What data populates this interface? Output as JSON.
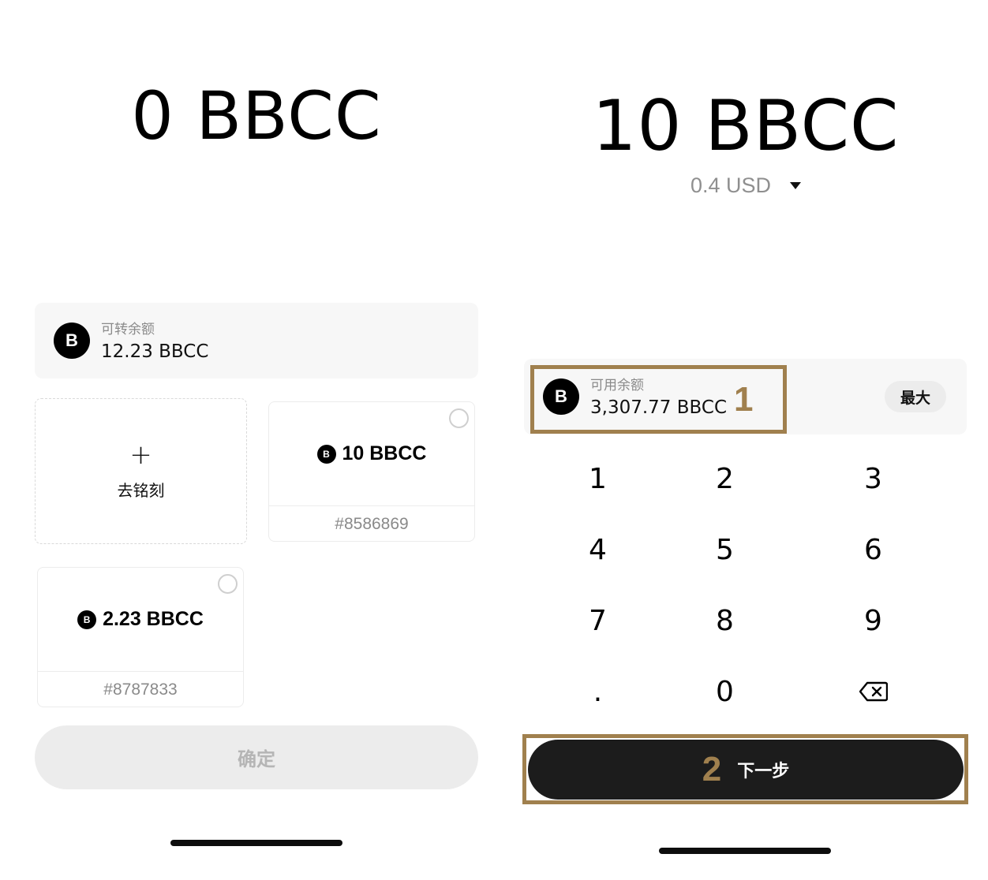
{
  "left_screen": {
    "amount": "0 BBCC",
    "balance_card": {
      "coin_symbol": "B",
      "label": "可转余额",
      "value": "12.23 BBCC"
    },
    "inscribe_tile": {
      "plus": "+",
      "label": "去铭刻"
    },
    "inscriptions": [
      {
        "coin_symbol": "B",
        "amount": "10 BBCC",
        "id": "#8586869",
        "selected": false
      },
      {
        "coin_symbol": "B",
        "amount": "2.23 BBCC",
        "id": "#8787833",
        "selected": false
      }
    ],
    "confirm_label": "确定"
  },
  "right_screen": {
    "amount": "10 BBCC",
    "fiat_value": "0.4 USD",
    "available_card": {
      "coin_symbol": "B",
      "label": "可用余额",
      "value": "3,307.77 BBCC",
      "max_label": "最大"
    },
    "keypad": {
      "keys": [
        "1",
        "2",
        "3",
        "4",
        "5",
        "6",
        "7",
        "8",
        "9",
        ".",
        "0"
      ]
    },
    "next_label": "下一步"
  },
  "annotations": {
    "step1": "1",
    "step2": "2",
    "color": "#a0804e"
  }
}
